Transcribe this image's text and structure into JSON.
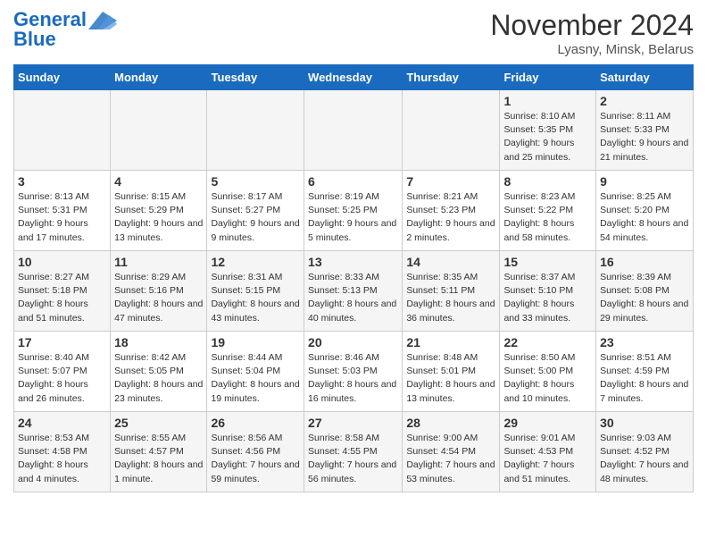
{
  "logo": {
    "line1": "General",
    "line2": "Blue"
  },
  "header": {
    "month": "November 2024",
    "location": "Lyasny, Minsk, Belarus"
  },
  "weekdays": [
    "Sunday",
    "Monday",
    "Tuesday",
    "Wednesday",
    "Thursday",
    "Friday",
    "Saturday"
  ],
  "weeks": [
    [
      {
        "day": "",
        "info": ""
      },
      {
        "day": "",
        "info": ""
      },
      {
        "day": "",
        "info": ""
      },
      {
        "day": "",
        "info": ""
      },
      {
        "day": "",
        "info": ""
      },
      {
        "day": "1",
        "info": "Sunrise: 8:10 AM\nSunset: 5:35 PM\nDaylight: 9 hours\nand 25 minutes."
      },
      {
        "day": "2",
        "info": "Sunrise: 8:11 AM\nSunset: 5:33 PM\nDaylight: 9 hours\nand 21 minutes."
      }
    ],
    [
      {
        "day": "3",
        "info": "Sunrise: 8:13 AM\nSunset: 5:31 PM\nDaylight: 9 hours\nand 17 minutes."
      },
      {
        "day": "4",
        "info": "Sunrise: 8:15 AM\nSunset: 5:29 PM\nDaylight: 9 hours\nand 13 minutes."
      },
      {
        "day": "5",
        "info": "Sunrise: 8:17 AM\nSunset: 5:27 PM\nDaylight: 9 hours\nand 9 minutes."
      },
      {
        "day": "6",
        "info": "Sunrise: 8:19 AM\nSunset: 5:25 PM\nDaylight: 9 hours\nand 5 minutes."
      },
      {
        "day": "7",
        "info": "Sunrise: 8:21 AM\nSunset: 5:23 PM\nDaylight: 9 hours\nand 2 minutes."
      },
      {
        "day": "8",
        "info": "Sunrise: 8:23 AM\nSunset: 5:22 PM\nDaylight: 8 hours\nand 58 minutes."
      },
      {
        "day": "9",
        "info": "Sunrise: 8:25 AM\nSunset: 5:20 PM\nDaylight: 8 hours\nand 54 minutes."
      }
    ],
    [
      {
        "day": "10",
        "info": "Sunrise: 8:27 AM\nSunset: 5:18 PM\nDaylight: 8 hours\nand 51 minutes."
      },
      {
        "day": "11",
        "info": "Sunrise: 8:29 AM\nSunset: 5:16 PM\nDaylight: 8 hours\nand 47 minutes."
      },
      {
        "day": "12",
        "info": "Sunrise: 8:31 AM\nSunset: 5:15 PM\nDaylight: 8 hours\nand 43 minutes."
      },
      {
        "day": "13",
        "info": "Sunrise: 8:33 AM\nSunset: 5:13 PM\nDaylight: 8 hours\nand 40 minutes."
      },
      {
        "day": "14",
        "info": "Sunrise: 8:35 AM\nSunset: 5:11 PM\nDaylight: 8 hours\nand 36 minutes."
      },
      {
        "day": "15",
        "info": "Sunrise: 8:37 AM\nSunset: 5:10 PM\nDaylight: 8 hours\nand 33 minutes."
      },
      {
        "day": "16",
        "info": "Sunrise: 8:39 AM\nSunset: 5:08 PM\nDaylight: 8 hours\nand 29 minutes."
      }
    ],
    [
      {
        "day": "17",
        "info": "Sunrise: 8:40 AM\nSunset: 5:07 PM\nDaylight: 8 hours\nand 26 minutes."
      },
      {
        "day": "18",
        "info": "Sunrise: 8:42 AM\nSunset: 5:05 PM\nDaylight: 8 hours\nand 23 minutes."
      },
      {
        "day": "19",
        "info": "Sunrise: 8:44 AM\nSunset: 5:04 PM\nDaylight: 8 hours\nand 19 minutes."
      },
      {
        "day": "20",
        "info": "Sunrise: 8:46 AM\nSunset: 5:03 PM\nDaylight: 8 hours\nand 16 minutes."
      },
      {
        "day": "21",
        "info": "Sunrise: 8:48 AM\nSunset: 5:01 PM\nDaylight: 8 hours\nand 13 minutes."
      },
      {
        "day": "22",
        "info": "Sunrise: 8:50 AM\nSunset: 5:00 PM\nDaylight: 8 hours\nand 10 minutes."
      },
      {
        "day": "23",
        "info": "Sunrise: 8:51 AM\nSunset: 4:59 PM\nDaylight: 8 hours\nand 7 minutes."
      }
    ],
    [
      {
        "day": "24",
        "info": "Sunrise: 8:53 AM\nSunset: 4:58 PM\nDaylight: 8 hours\nand 4 minutes."
      },
      {
        "day": "25",
        "info": "Sunrise: 8:55 AM\nSunset: 4:57 PM\nDaylight: 8 hours\nand 1 minute."
      },
      {
        "day": "26",
        "info": "Sunrise: 8:56 AM\nSunset: 4:56 PM\nDaylight: 7 hours\nand 59 minutes."
      },
      {
        "day": "27",
        "info": "Sunrise: 8:58 AM\nSunset: 4:55 PM\nDaylight: 7 hours\nand 56 minutes."
      },
      {
        "day": "28",
        "info": "Sunrise: 9:00 AM\nSunset: 4:54 PM\nDaylight: 7 hours\nand 53 minutes."
      },
      {
        "day": "29",
        "info": "Sunrise: 9:01 AM\nSunset: 4:53 PM\nDaylight: 7 hours\nand 51 minutes."
      },
      {
        "day": "30",
        "info": "Sunrise: 9:03 AM\nSunset: 4:52 PM\nDaylight: 7 hours\nand 48 minutes."
      }
    ]
  ]
}
